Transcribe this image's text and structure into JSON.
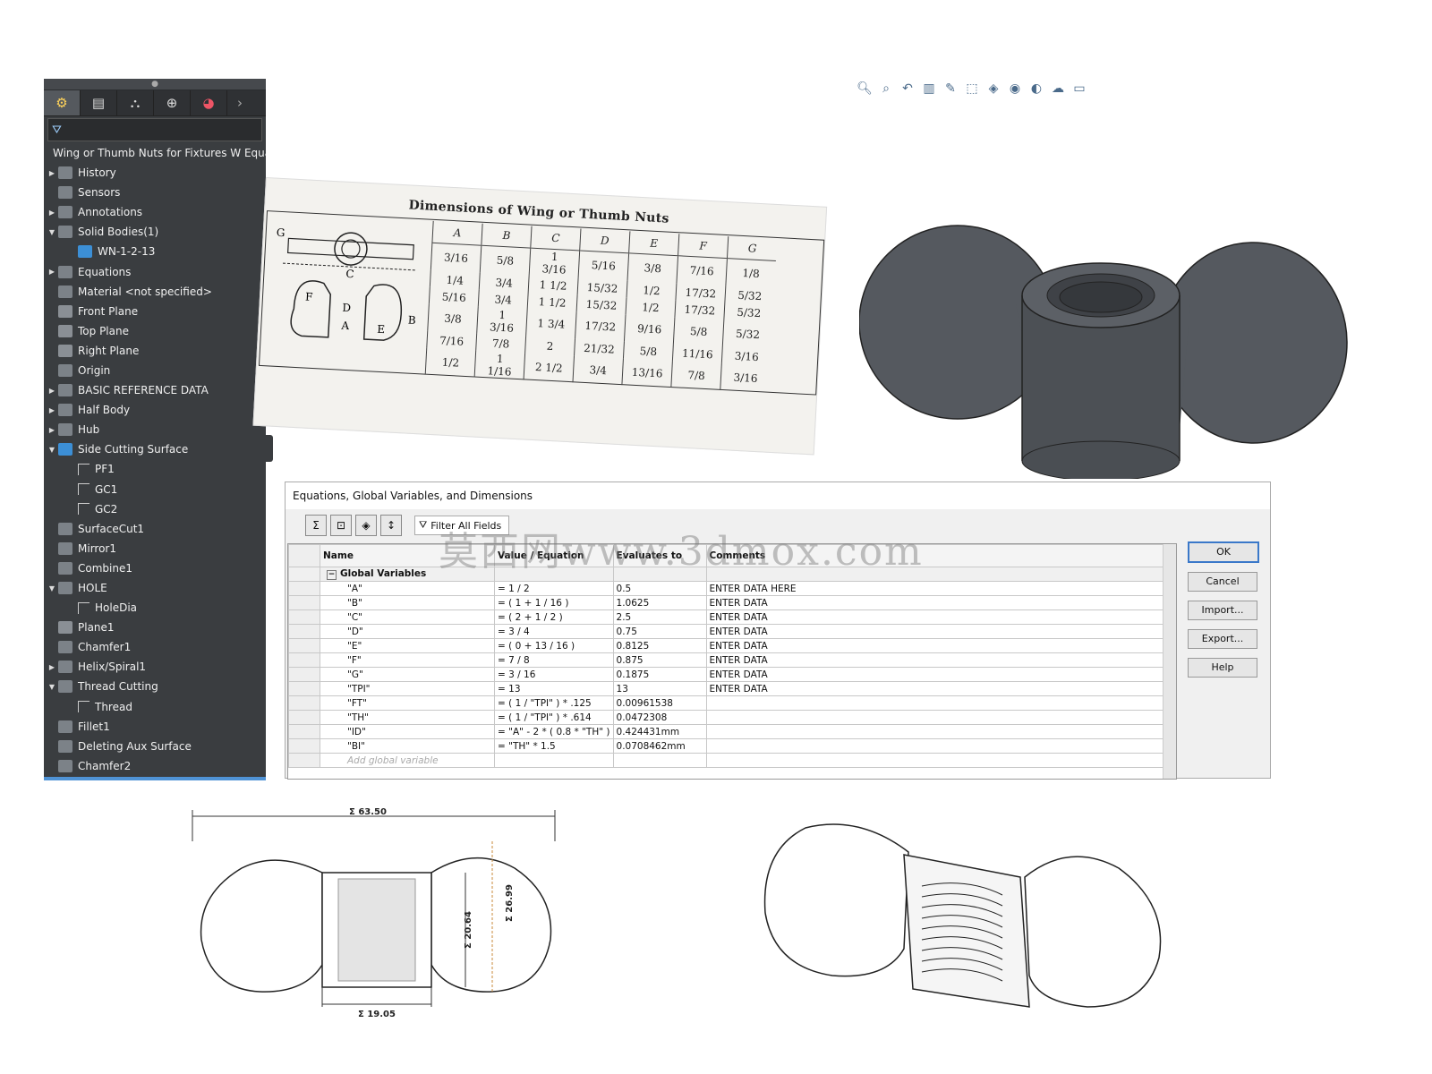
{
  "tree": {
    "root_label": "Wing or Thumb Nuts for Fixtures W Equat",
    "items": [
      {
        "label": "History",
        "arrow": "▶",
        "icon": "history-icon"
      },
      {
        "label": "Sensors",
        "arrow": "",
        "icon": "sensor-icon"
      },
      {
        "label": "Annotations",
        "arrow": "▶",
        "icon": "annotation-icon"
      },
      {
        "label": "Solid Bodies(1)",
        "arrow": "▼",
        "icon": "solid-bodies-icon"
      },
      {
        "label": "WN-1-2-13",
        "arrow": "",
        "icon": "body-icon",
        "indent": 1
      },
      {
        "label": "Equations",
        "arrow": "▶",
        "icon": "equations-icon"
      },
      {
        "label": "Material <not specified>",
        "arrow": "",
        "icon": "material-icon"
      },
      {
        "label": "Front Plane",
        "arrow": "",
        "icon": "plane-icon"
      },
      {
        "label": "Top Plane",
        "arrow": "",
        "icon": "plane-icon"
      },
      {
        "label": "Right Plane",
        "arrow": "",
        "icon": "plane-icon"
      },
      {
        "label": "Origin",
        "arrow": "",
        "icon": "origin-icon"
      },
      {
        "label": "BASIC REFERENCE DATA",
        "arrow": "▶",
        "icon": "folder-icon"
      },
      {
        "label": "Half Body",
        "arrow": "▶",
        "icon": "feature-icon"
      },
      {
        "label": "Hub",
        "arrow": "▶",
        "icon": "feature-icon"
      },
      {
        "label": "Side Cutting Surface",
        "arrow": "▼",
        "icon": "surface-icon"
      },
      {
        "label": "PF1",
        "arrow": "",
        "icon": "sketch-icon",
        "indent": 1
      },
      {
        "label": "GC1",
        "arrow": "",
        "icon": "sketch-icon",
        "indent": 1
      },
      {
        "label": "GC2",
        "arrow": "",
        "icon": "sketch-icon",
        "indent": 1
      },
      {
        "label": "SurfaceCut1",
        "arrow": "",
        "icon": "surface-cut-icon"
      },
      {
        "label": "Mirror1",
        "arrow": "",
        "icon": "mirror-icon"
      },
      {
        "label": "Combine1",
        "arrow": "",
        "icon": "combine-icon"
      },
      {
        "label": "HOLE",
        "arrow": "▼",
        "icon": "hole-icon"
      },
      {
        "label": "HoleDia",
        "arrow": "",
        "icon": "sketch-icon",
        "indent": 1
      },
      {
        "label": "Plane1",
        "arrow": "",
        "icon": "plane-icon"
      },
      {
        "label": "Chamfer1",
        "arrow": "",
        "icon": "chamfer-icon"
      },
      {
        "label": "Helix/Spiral1",
        "arrow": "▶",
        "icon": "helix-icon"
      },
      {
        "label": "Thread Cutting",
        "arrow": "▼",
        "icon": "cut-icon"
      },
      {
        "label": "Thread",
        "arrow": "",
        "icon": "sketch-icon",
        "indent": 1
      },
      {
        "label": "Fillet1",
        "arrow": "",
        "icon": "fillet-icon"
      },
      {
        "label": "Deleting Aux Surface",
        "arrow": "",
        "icon": "delete-body-icon"
      },
      {
        "label": "Chamfer2",
        "arrow": "",
        "icon": "chamfer-icon"
      }
    ]
  },
  "dim_table": {
    "title": "Dimensions of Wing or Thumb Nuts",
    "headers": [
      "A",
      "B",
      "C",
      "D",
      "E",
      "F",
      "G"
    ],
    "rows": [
      [
        "3/16",
        "5/8",
        "1 3/16",
        "5/16",
        "3/8",
        "7/16",
        "1/8"
      ],
      [
        "1/4",
        "3/4",
        "1 1/2",
        "15/32",
        "1/2",
        "17/32",
        "5/32"
      ],
      [
        "5/16",
        "3/4",
        "1 1/2",
        "15/32",
        "1/2",
        "17/32",
        "5/32"
      ],
      [
        "3/8",
        "1 3/16",
        "1 3/4",
        "17/32",
        "9/16",
        "5/8",
        "5/32"
      ],
      [
        "7/16",
        "7/8",
        "2",
        "21/32",
        "5/8",
        "11/16",
        "3/16"
      ],
      [
        "1/2",
        "1 1/16",
        "2 1/2",
        "3/4",
        "13/16",
        "7/8",
        "3/16"
      ]
    ],
    "sketch_labels": [
      "G",
      "C",
      "F",
      "D",
      "A",
      "B",
      "E"
    ]
  },
  "dialog": {
    "title": "Equations, Global Variables, and Dimensions",
    "filter_label": "Filter All Fields",
    "columns": [
      "Name",
      "Value / Equation",
      "Evaluates to",
      "Comments"
    ],
    "group_label": "Global Variables",
    "rows": [
      {
        "name": "\"A\"",
        "eq": "= 1 / 2",
        "val": "0.5",
        "comment": "ENTER DATA HERE"
      },
      {
        "name": "\"B\"",
        "eq": "= ( 1 + 1 / 16 )",
        "val": "1.0625",
        "comment": "ENTER DATA"
      },
      {
        "name": "\"C\"",
        "eq": "= ( 2 + 1 / 2 )",
        "val": "2.5",
        "comment": "ENTER DATA"
      },
      {
        "name": "\"D\"",
        "eq": "= 3 / 4",
        "val": "0.75",
        "comment": "ENTER DATA"
      },
      {
        "name": "\"E\"",
        "eq": "= ( 0 + 13 / 16 )",
        "val": "0.8125",
        "comment": "ENTER DATA"
      },
      {
        "name": "\"F\"",
        "eq": "= 7 / 8",
        "val": "0.875",
        "comment": "ENTER DATA"
      },
      {
        "name": "\"G\"",
        "eq": "= 3 / 16",
        "val": "0.1875",
        "comment": "ENTER DATA"
      },
      {
        "name": "\"TPI\"",
        "eq": "= 13",
        "val": "13",
        "comment": "ENTER DATA"
      },
      {
        "name": "\"FT\"",
        "eq": "= ( 1 / \"TPI\" ) * .125",
        "val": "0.00961538",
        "comment": ""
      },
      {
        "name": "\"TH\"",
        "eq": "= ( 1 / \"TPI\" ) * .614",
        "val": "0.0472308",
        "comment": ""
      },
      {
        "name": "\"ID\"",
        "eq": "= \"A\" - 2 * ( 0.8 * \"TH\" )",
        "val": "0.424431mm",
        "comment": ""
      },
      {
        "name": "\"BI\"",
        "eq": "= \"TH\" * 1.5",
        "val": "0.0708462mm",
        "comment": ""
      }
    ],
    "add_placeholder": "Add global variable",
    "buttons": {
      "ok": "OK",
      "cancel": "Cancel",
      "import": "Import...",
      "export": "Export...",
      "help": "Help"
    }
  },
  "watermark": "莫西网www.3dmox.com",
  "drawing": {
    "dim_total": "Σ 63.50",
    "dim_hub": "Σ 19.05",
    "dim_height1": "Σ 20.64",
    "dim_height2": "Σ 26.99"
  },
  "colors": {
    "tree_bg": "#3a3d40",
    "accent": "#3a78c9",
    "nut_gray": "#55595f"
  }
}
